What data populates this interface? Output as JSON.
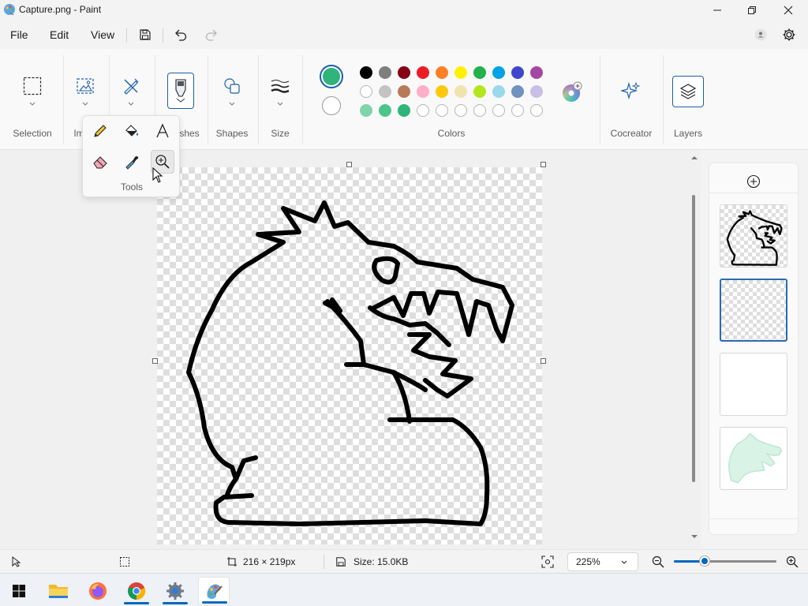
{
  "window": {
    "title": "Capture.png - Paint"
  },
  "menu": {
    "file": "File",
    "edit": "Edit",
    "view": "View"
  },
  "ribbon": {
    "selection_label": "Selection",
    "image_label": "Im",
    "brushes_label": "shes",
    "shapes_label": "Shapes",
    "size_label": "Size",
    "colors_label": "Colors",
    "cocreator_label": "Cocreator",
    "layers_label": "Layers"
  },
  "tools_flyout": {
    "label": "Tools",
    "items": [
      "pencil-icon",
      "fill-bucket-icon",
      "text-icon",
      "eraser-icon",
      "color-picker-icon",
      "magnifier-icon"
    ]
  },
  "colors": {
    "primary": "#2fb47c",
    "secondary": "#ffffff",
    "row1": [
      "#000000",
      "#7f7f7f",
      "#880015",
      "#ed1c24",
      "#ff7f27",
      "#fff200",
      "#22b14c",
      "#00a2e8",
      "#3f48cc",
      "#a349a4"
    ],
    "row2": [
      "#ffffff",
      "#c3c3c3",
      "#b97a57",
      "#ffaec9",
      "#ffc90e",
      "#efe4b0",
      "#b5e61d",
      "#99d9ea",
      "#7092be",
      "#c8bfe7"
    ],
    "row3": [
      "#7fd4a9",
      "#4cc58b",
      "#2fb47c",
      "",
      "",
      "",
      "",
      "",
      "",
      ""
    ]
  },
  "status": {
    "canvas_size": "216 × 219px",
    "file_size": "Size: 15.0KB",
    "zoom": "225%",
    "zoom_fraction": 0.3
  },
  "taskbar": {
    "apps": [
      "windows-start-icon",
      "file-explorer-icon",
      "firefox-icon",
      "chrome-icon",
      "settings-icon",
      "paint-icon"
    ]
  }
}
